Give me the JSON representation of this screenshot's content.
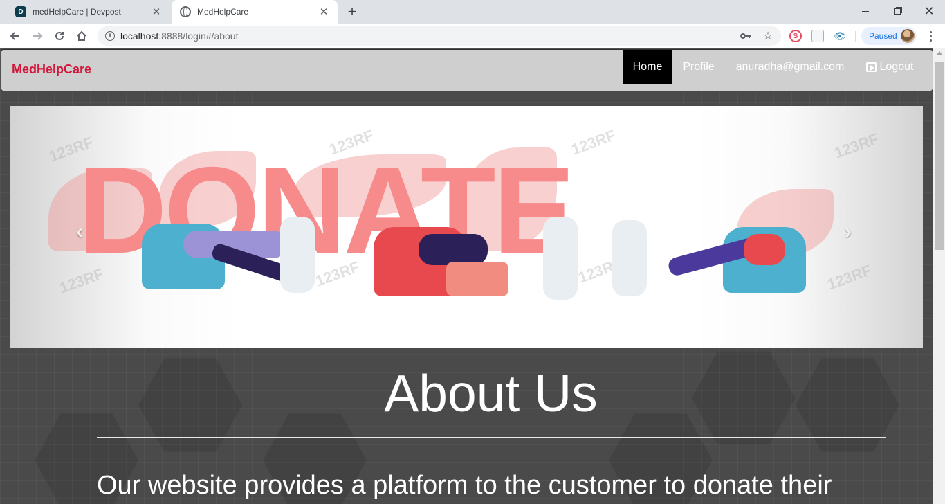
{
  "browser": {
    "tabs": [
      {
        "title": "medHelpCare | Devpost",
        "favicon": "devpost-icon",
        "active": false
      },
      {
        "title": "MedHelpCare",
        "favicon": "globe-icon",
        "active": true
      }
    ],
    "url_host": "localhost",
    "url_rest": ":8888/login#/about",
    "profile_status": "Paused"
  },
  "site": {
    "brand": "MedHelpCare",
    "brand_color": "#d1163a",
    "nav": {
      "home": "Home",
      "profile": "Profile",
      "email": "anuradha@gmail.com",
      "logout": "Logout"
    }
  },
  "carousel": {
    "banner_word": "DONATE",
    "watermark": "123RF",
    "prev_label": "‹",
    "next_label": "›"
  },
  "about": {
    "title": "About Us",
    "text": "Our website provides a platform to the customer to donate their"
  }
}
